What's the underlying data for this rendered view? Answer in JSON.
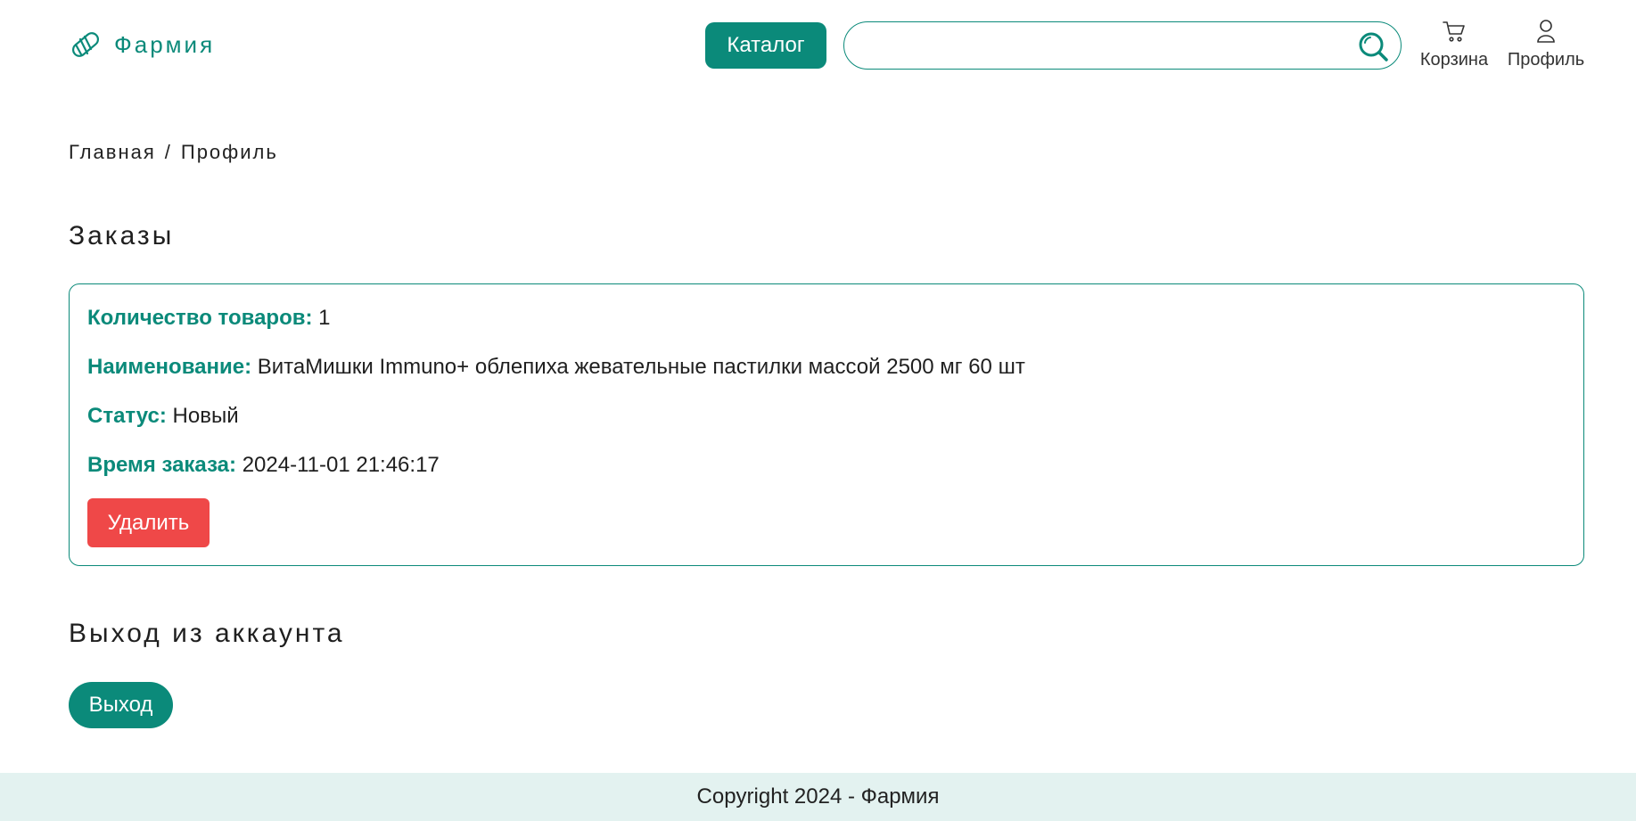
{
  "header": {
    "logo_text": "Фармия",
    "catalog_label": "Каталог",
    "search": {
      "value": "",
      "placeholder": ""
    },
    "nav": {
      "cart_label": "Корзина",
      "profile_label": "Профиль"
    }
  },
  "breadcrumb": {
    "home": "Главная",
    "separator": "/",
    "current": "Профиль"
  },
  "orders": {
    "title": "Заказы",
    "items": [
      {
        "quantity_label": "Количество товаров:",
        "quantity_value": "1",
        "name_label": "Наименование:",
        "name_value": "ВитаМишки Immuno+ облепиха жевательные пастилки массой 2500 мг 60 шт",
        "status_label": "Статус:",
        "status_value": "Новый",
        "time_label": "Время заказа:",
        "time_value": "2024-11-01 21:46:17",
        "delete_label": "Удалить"
      }
    ]
  },
  "logout": {
    "title": "Выход из аккаунта",
    "button_label": "Выход"
  },
  "footer": {
    "copyright": "Copyright 2024 - Фармия"
  },
  "colors": {
    "accent": "#0b8a7a",
    "danger": "#ef4848",
    "footer_bg": "#e3f2f0"
  },
  "icons": {
    "logo": "pill-icon",
    "search": "search-icon",
    "cart": "cart-icon",
    "profile": "user-icon"
  }
}
